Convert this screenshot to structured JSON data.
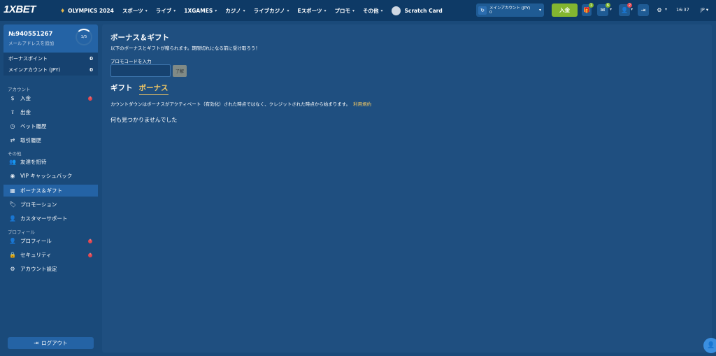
{
  "brand": {
    "logo_x": "1X",
    "logo_bet": "BET"
  },
  "nav": {
    "items": [
      {
        "label": "OLYMPICS 2024",
        "chevron": false
      },
      {
        "label": "スポーツ",
        "chevron": true
      },
      {
        "label": "ライブ",
        "chevron": true
      },
      {
        "label": "1XGAMES",
        "chevron": true
      },
      {
        "label": "カジノ",
        "chevron": true
      },
      {
        "label": "ライブカジノ",
        "chevron": true
      },
      {
        "label": "Eスポーツ",
        "chevron": true
      },
      {
        "label": "プロモ",
        "chevron": true
      },
      {
        "label": "その他",
        "chevron": true
      },
      {
        "label": "Scratch Card",
        "chevron": false
      }
    ]
  },
  "account": {
    "label": "メインアカウント (JPY)",
    "value": "0"
  },
  "header": {
    "deposit_label": "入金",
    "gift_badge": "1",
    "mail_badge": "6",
    "profile_badge": "2",
    "time": "16:37",
    "lang": "JP"
  },
  "sidebar": {
    "user_id": "№940551267",
    "add_email": "メールアドレスを追加",
    "level": "1/5",
    "balances": [
      {
        "label": "ボーナスポイント",
        "value": "0"
      },
      {
        "label": "メインアカウント (JPY)",
        "value": "0"
      }
    ],
    "sections": {
      "account": "アカウント",
      "other": "その他",
      "profile": "プロフィール"
    },
    "items": [
      {
        "label": "入金",
        "alert": "!"
      },
      {
        "label": "出金"
      },
      {
        "label": "ベット履歴"
      },
      {
        "label": "取引履歴"
      },
      {
        "label": "友達を招待"
      },
      {
        "label": "VIP キャッシュバック"
      },
      {
        "label": "ボーナス＆ギフト"
      },
      {
        "label": "プロモーション"
      },
      {
        "label": "カスタマーサポート"
      },
      {
        "label": "プロフィール",
        "alert": "!"
      },
      {
        "label": "セキュリティ",
        "alert": "!"
      },
      {
        "label": "アカウント設定"
      }
    ],
    "logout_label": "ログアウト"
  },
  "main": {
    "title": "ボーナス＆ギフト",
    "subtitle": "以下のボーナスとギフトが贈られます。期限切れになる前に受け取ろう！",
    "promo_label": "プロモコードを入力",
    "promo_value": "",
    "promo_button": "了解",
    "tabs": [
      {
        "label": "ギフト",
        "active": false
      },
      {
        "label": "ボーナス",
        "active": true
      }
    ],
    "note": "カウントダウンはボーナスがアクティベート（有効化）された時点ではなく、クレジットされた時点から始まります。",
    "note_link": "利用規約",
    "empty_message": "何も見つかりませんでした"
  },
  "colors": {
    "topbar": "#0e3a66",
    "background": "#1a4a7a",
    "panel": "#1f4f80",
    "accent_blue": "#2463a5",
    "deposit_green": "#83b630",
    "highlight_gold": "#f2c864",
    "alert_red": "#e0464f"
  }
}
